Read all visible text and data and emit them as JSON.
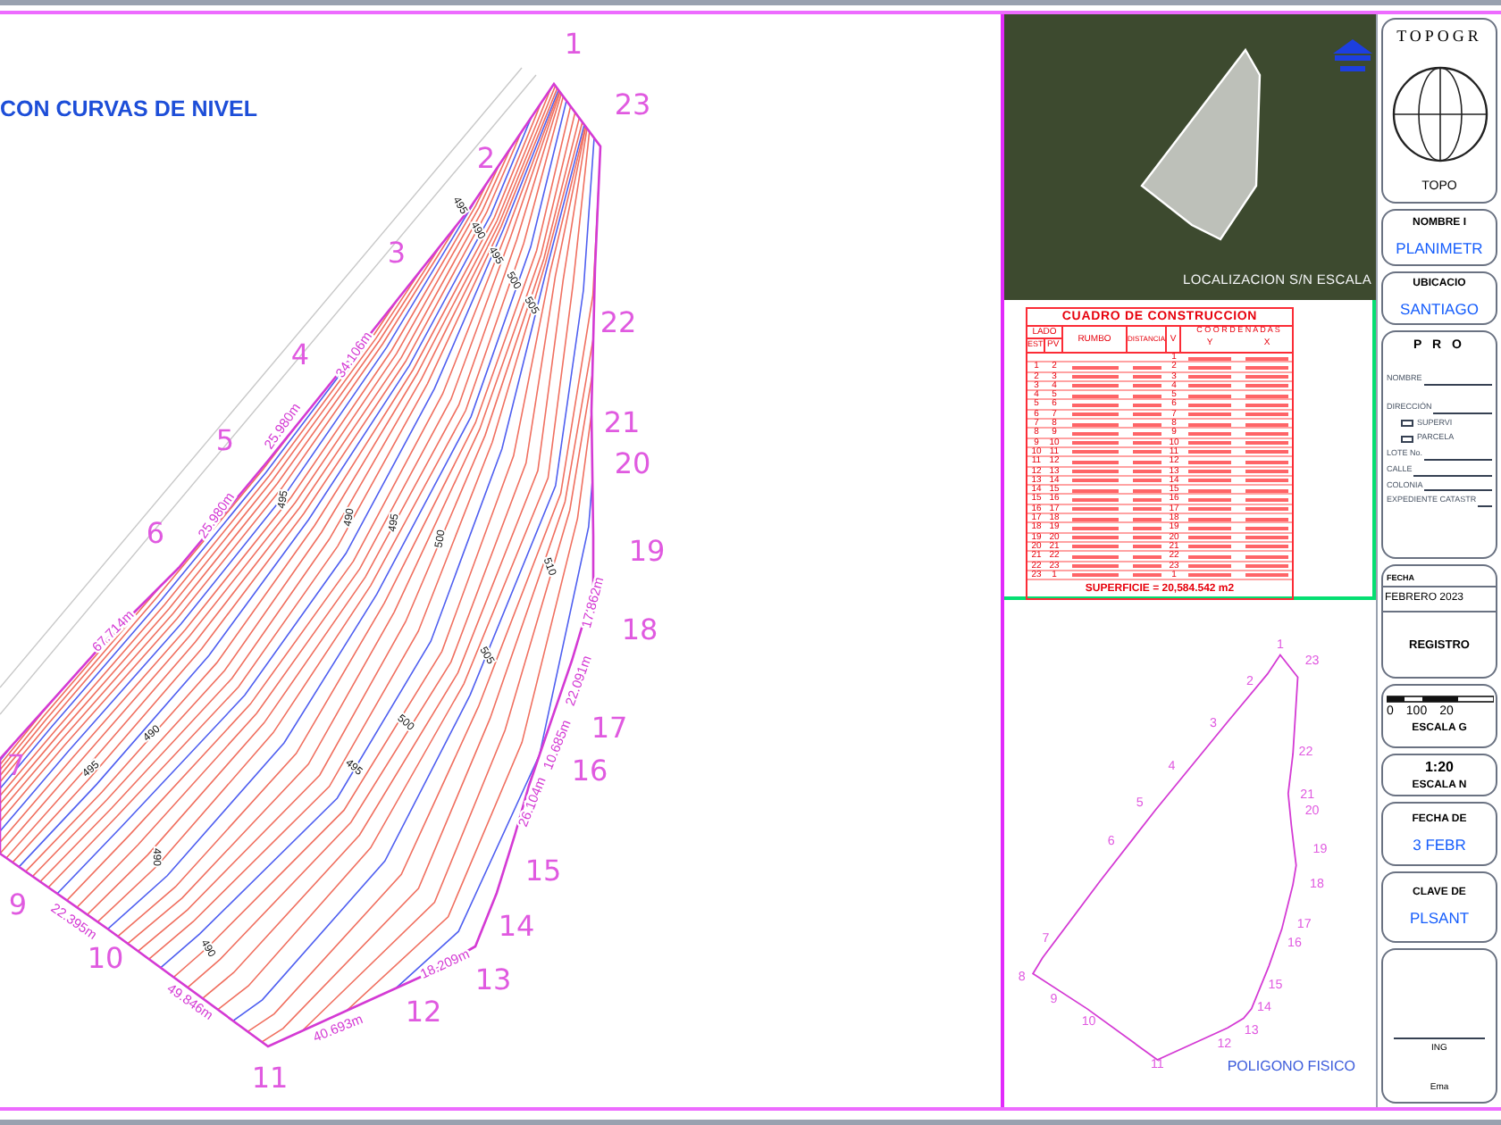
{
  "plan": {
    "title": "CON CURVAS DE NIVEL",
    "vertices": [
      "1",
      "23",
      "2",
      "3",
      "22",
      "4",
      "21",
      "5",
      "20",
      "6",
      "19",
      "18",
      "17",
      "7",
      "16",
      "15",
      "9",
      "14",
      "10",
      "13",
      "12",
      "11"
    ],
    "distances": [
      "34.106m",
      "25.980m",
      "25.980m",
      "67.714m",
      "22.395m",
      "49.846m",
      "40.693m",
      "18.209m",
      "26.104m",
      "10.685m",
      "22.091m",
      "17.862m"
    ],
    "contour_labels": [
      "495",
      "490",
      "495",
      "500",
      "505",
      "495",
      "490",
      "495",
      "500",
      "510",
      "505",
      "500",
      "495",
      "490",
      "495",
      "490",
      "490"
    ]
  },
  "location_map": {
    "caption": "LOCALIZACION S/N ESCALA"
  },
  "construction_table": {
    "title": "CUADRO DE CONSTRUCCION",
    "group_header": "LADO",
    "columns": [
      "EST",
      "PV",
      "RUMBO",
      "DISTANCIA",
      "V",
      "C O O R D E N A D A S"
    ],
    "coordinate_columns": [
      "Y",
      "X"
    ],
    "rows": [
      {
        "est": "",
        "pv": "",
        "v": "1"
      },
      {
        "est": "1",
        "pv": "2",
        "v": "2"
      },
      {
        "est": "2",
        "pv": "3",
        "v": "3"
      },
      {
        "est": "3",
        "pv": "4",
        "v": "4"
      },
      {
        "est": "4",
        "pv": "5",
        "v": "5"
      },
      {
        "est": "5",
        "pv": "6",
        "v": "6"
      },
      {
        "est": "6",
        "pv": "7",
        "v": "7"
      },
      {
        "est": "7",
        "pv": "8",
        "v": "8"
      },
      {
        "est": "8",
        "pv": "9",
        "v": "9"
      },
      {
        "est": "9",
        "pv": "10",
        "v": "10"
      },
      {
        "est": "10",
        "pv": "11",
        "v": "11"
      },
      {
        "est": "11",
        "pv": "12",
        "v": "12"
      },
      {
        "est": "12",
        "pv": "13",
        "v": "13"
      },
      {
        "est": "13",
        "pv": "14",
        "v": "14"
      },
      {
        "est": "14",
        "pv": "15",
        "v": "15"
      },
      {
        "est": "15",
        "pv": "16",
        "v": "16"
      },
      {
        "est": "16",
        "pv": "17",
        "v": "17"
      },
      {
        "est": "17",
        "pv": "18",
        "v": "18"
      },
      {
        "est": "18",
        "pv": "19",
        "v": "19"
      },
      {
        "est": "19",
        "pv": "20",
        "v": "20"
      },
      {
        "est": "20",
        "pv": "21",
        "v": "21"
      },
      {
        "est": "21",
        "pv": "22",
        "v": "22"
      },
      {
        "est": "22",
        "pv": "23",
        "v": "23"
      },
      {
        "est": "23",
        "pv": "1",
        "v": "1"
      }
    ],
    "area": "SUPERFICIE = 20,584.542 m2"
  },
  "polygon_view": {
    "vertices": [
      "1",
      "23",
      "2",
      "3",
      "22",
      "4",
      "21",
      "5",
      "20",
      "6",
      "19",
      "18",
      "17",
      "7",
      "16",
      "8",
      "15",
      "9",
      "14",
      "10",
      "13",
      "12",
      "11"
    ],
    "caption": "POLIGONO FISICO"
  },
  "title_block": {
    "logo": {
      "arc_text": "TOPOGR",
      "caption": "TOPO"
    },
    "project_name": {
      "label": "NOMBRE I",
      "value": "PLANIMETR"
    },
    "location": {
      "label": "UBICACIO",
      "value": "SANTIAGO"
    },
    "owner": {
      "heading": "P R O",
      "fields": [
        "NOMBRE",
        "DIRECCIÓN"
      ],
      "options": [
        {
          "label": "SUPERVI",
          "checked": false
        },
        {
          "label": "PARCELA",
          "checked": false
        }
      ],
      "details": [
        "LOTE No.",
        "CALLE",
        "COLONIA",
        "EXPEDIENTE CATASTR"
      ]
    },
    "dates": {
      "label": "FECHA",
      "value": "FEBRERO 2023",
      "registry": "REGISTRO"
    },
    "graphic_scale": {
      "ticks": [
        "0",
        "100",
        "20"
      ],
      "label": "ESCALA G"
    },
    "numeric_scale": {
      "value": "1:20",
      "label": "ESCALA N"
    },
    "date_of": {
      "label": "FECHA DE",
      "value": "3 FEBR"
    },
    "key": {
      "label": "CLAVE DE",
      "value": "PLSANT"
    },
    "signature": {
      "title": "ING",
      "email": "Ema"
    }
  }
}
